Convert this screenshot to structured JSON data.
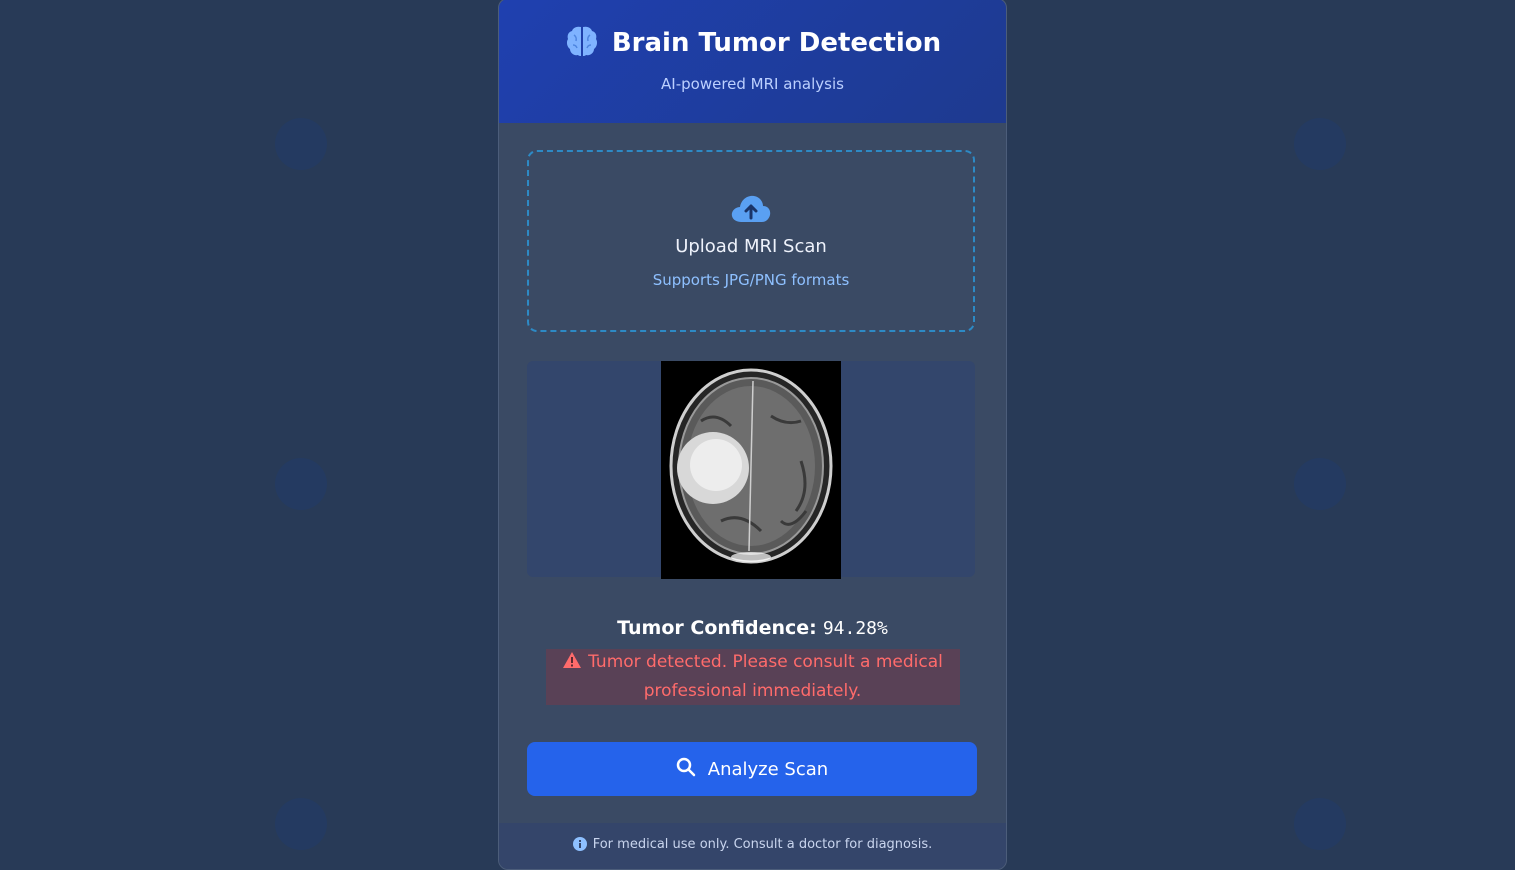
{
  "colors": {
    "page_bg": "#283a57",
    "header_bg": "#1f40b0",
    "accent": "#2563eb",
    "alert_text": "#ff6b6b",
    "upload_border": "#2d8ac5"
  },
  "header": {
    "icon": "brain-icon",
    "title": "Brain Tumor Detection",
    "subtitle": "AI-powered MRI analysis"
  },
  "upload": {
    "icon": "cloud-upload-icon",
    "title": "Upload MRI Scan",
    "subtitle": "Supports JPG/PNG formats"
  },
  "preview": {
    "image": "brain-mri-scan"
  },
  "result": {
    "confidence_label": "Tumor Confidence:",
    "confidence_value": "94.28%",
    "alert_icon": "warning-icon",
    "alert_text": "Tumor detected. Please consult a medical professional immediately."
  },
  "actions": {
    "analyze_icon": "search-icon",
    "analyze_label": "Analyze Scan"
  },
  "footer": {
    "icon": "info-icon",
    "text": "For medical use only. Consult a doctor for diagnosis."
  }
}
